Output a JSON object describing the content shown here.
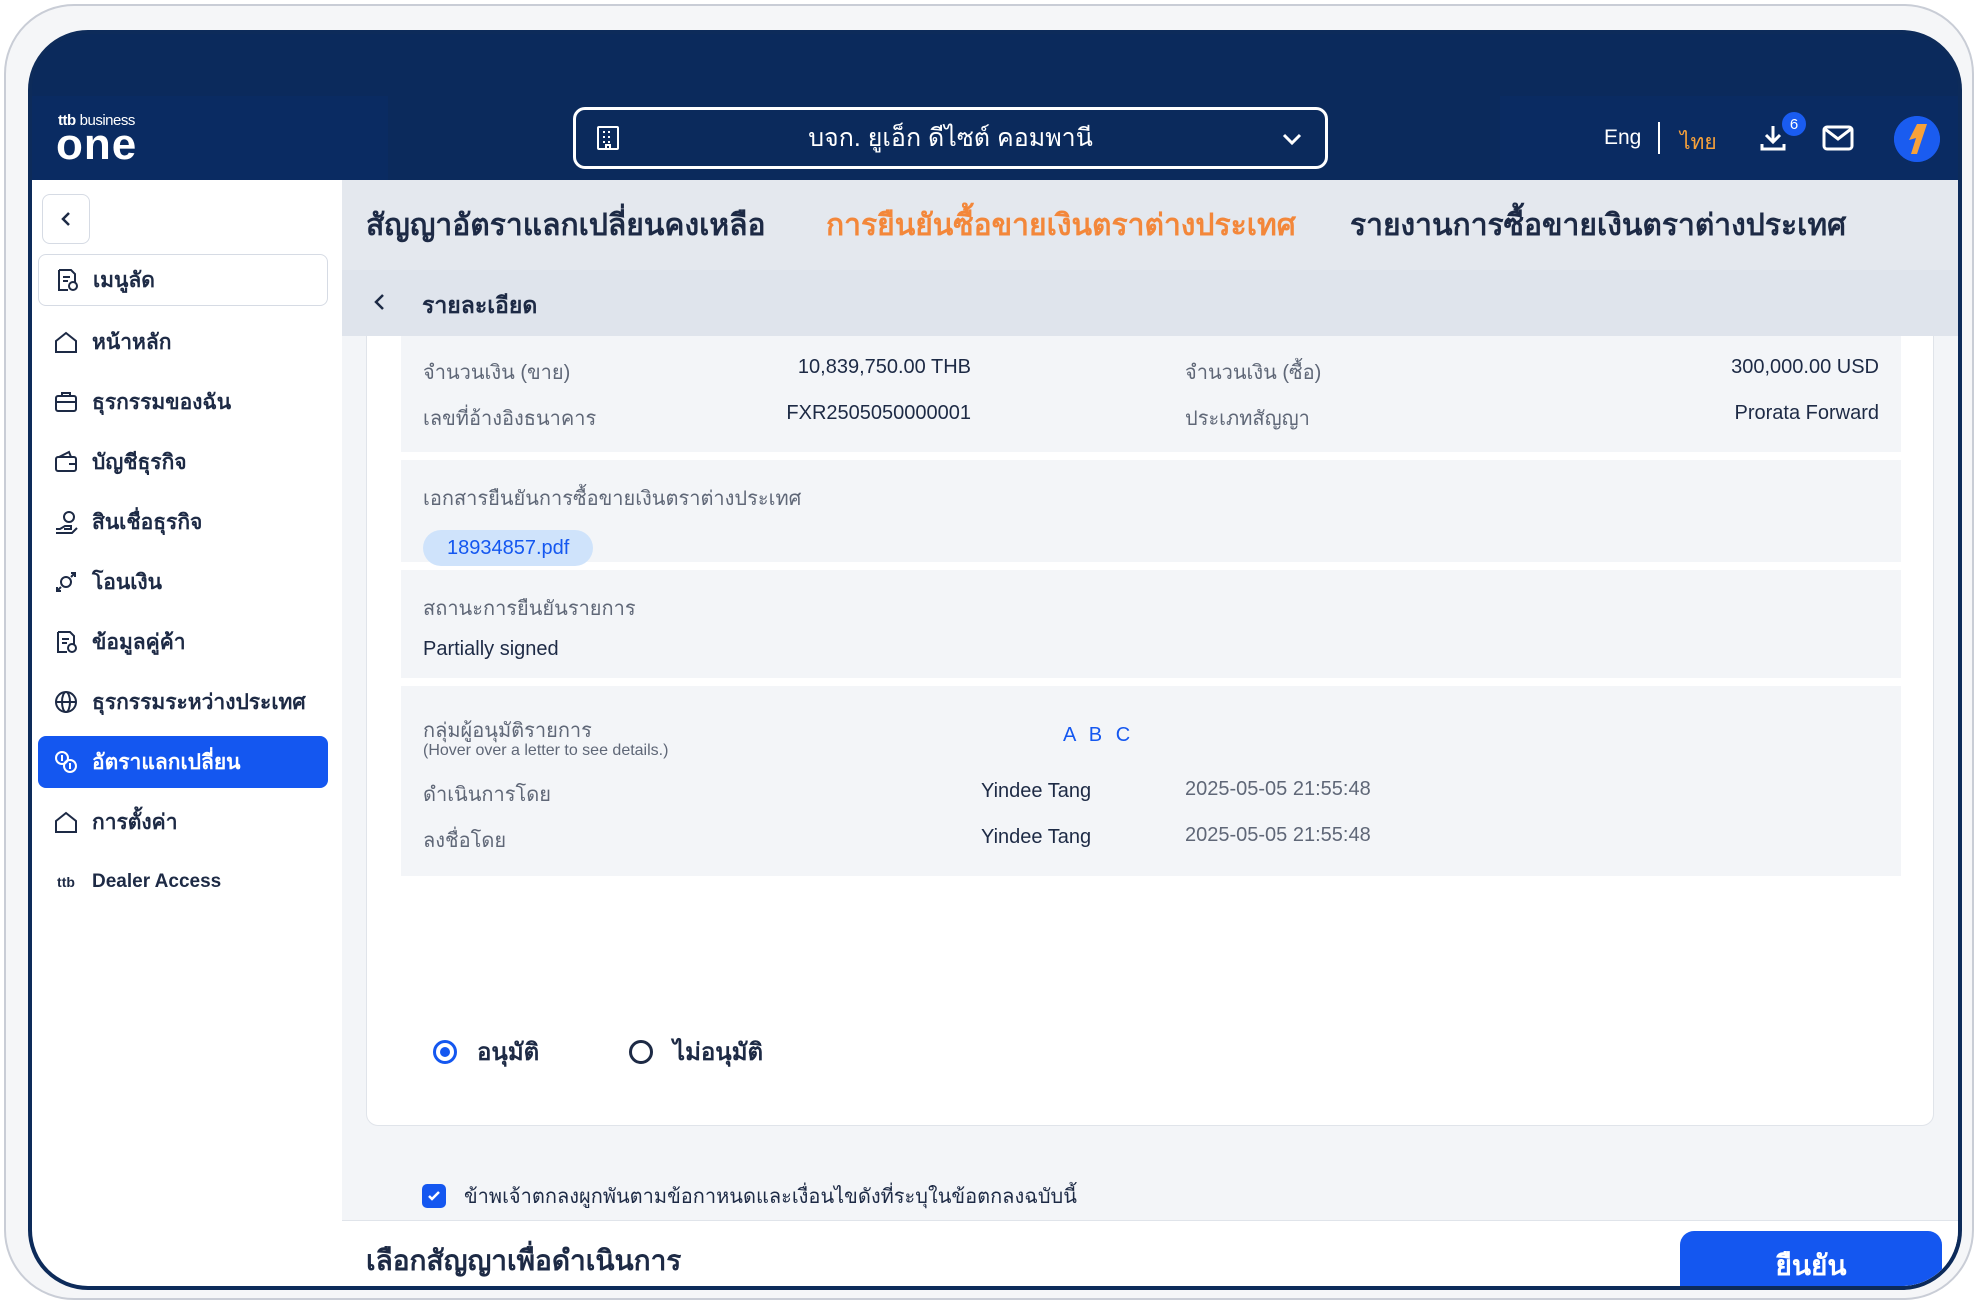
{
  "header": {
    "logo_small": "ttb",
    "logo_business": "business",
    "logo_main": "one",
    "company_name": "บจก. ยูเอ็ก ดีไซต์ คอมพานี",
    "lang_eng": "Eng",
    "lang_thai": "ไทย",
    "download_badge": "6"
  },
  "sidebar": {
    "items": [
      {
        "label": "เมนูลัด",
        "icon": "shortcut-icon"
      },
      {
        "label": "หน้าหลัก",
        "icon": "home-icon"
      },
      {
        "label": "ธุรกรรมของฉัน",
        "icon": "briefcase-icon"
      },
      {
        "label": "บัญชีธุรกิจ",
        "icon": "wallet-icon"
      },
      {
        "label": "สินเชื่อธุรกิจ",
        "icon": "loan-icon"
      },
      {
        "label": "โอนเงิน",
        "icon": "transfer-icon"
      },
      {
        "label": "ข้อมูลคู่ค้า",
        "icon": "partner-icon"
      },
      {
        "label": "ธุรกรรมระหว่างประเทศ",
        "icon": "globe-icon"
      },
      {
        "label": "อัตราแลกเปลี่ยน",
        "icon": "exchange-icon"
      },
      {
        "label": "การตั้งค่า",
        "icon": "settings-icon"
      },
      {
        "label": "Dealer Access",
        "icon": "ttb-icon"
      }
    ]
  },
  "tabs": [
    {
      "label": "สัญญาอัตราแลกเปลี่ยนคงเหลือ"
    },
    {
      "label": "การยืนยันซื้อขายเงินตราต่างประเทศ"
    },
    {
      "label": "รายงานการซื้อขายเงินตราต่างประเทศ"
    }
  ],
  "subheader": {
    "title": "รายละเอียด"
  },
  "details": {
    "sell_amount_label": "จำนวนเงิน (ขาย)",
    "sell_amount_value": "10,839,750.00 THB",
    "buy_amount_label": "จำนวนเงิน (ซื้อ)",
    "buy_amount_value": "300,000.00 USD",
    "ref_label": "เลขที่อ้างอิงธนาคาร",
    "ref_value": "FXR2505050000001",
    "contract_type_label": "ประเภทสัญญา",
    "contract_type_value": "Prorata Forward"
  },
  "document": {
    "label": "เอกสารยืนยันการซื้อขายเงินตราต่างประเทศ",
    "file": "18934857.pdf"
  },
  "status": {
    "label": "สถานะการยืนยันรายการ",
    "value": "Partially signed"
  },
  "approvers": {
    "label": "กลุ่มผู้อนุมัติรายการ",
    "hint": "(Hover over a letter to see details.)",
    "groups": "A B C",
    "processed_label": "ดำเนินการโดย",
    "processed_by": "Yindee Tang",
    "processed_time": "2025-05-05 21:55:48",
    "signed_label": "ลงชื่อโดย",
    "signed_by": "Yindee Tang",
    "signed_time": "2025-05-05 21:55:48"
  },
  "decision": {
    "approve": "อนุมัติ",
    "reject": "ไม่อนุมัติ"
  },
  "agreement": "ข้าพเจ้าตกลงผูกพันตามข้อกาหนดและเงื่อนไขดังที่ระบุในข้อตกลงฉบับนี้",
  "footer": {
    "text": "เลือกสัญญาเพื่อดำเนินการ",
    "confirm": "ยืนยัน"
  },
  "colors": {
    "brand_navy": "#0b2a5c",
    "accent_blue": "#1457f0",
    "accent_orange": "#f3873a"
  }
}
